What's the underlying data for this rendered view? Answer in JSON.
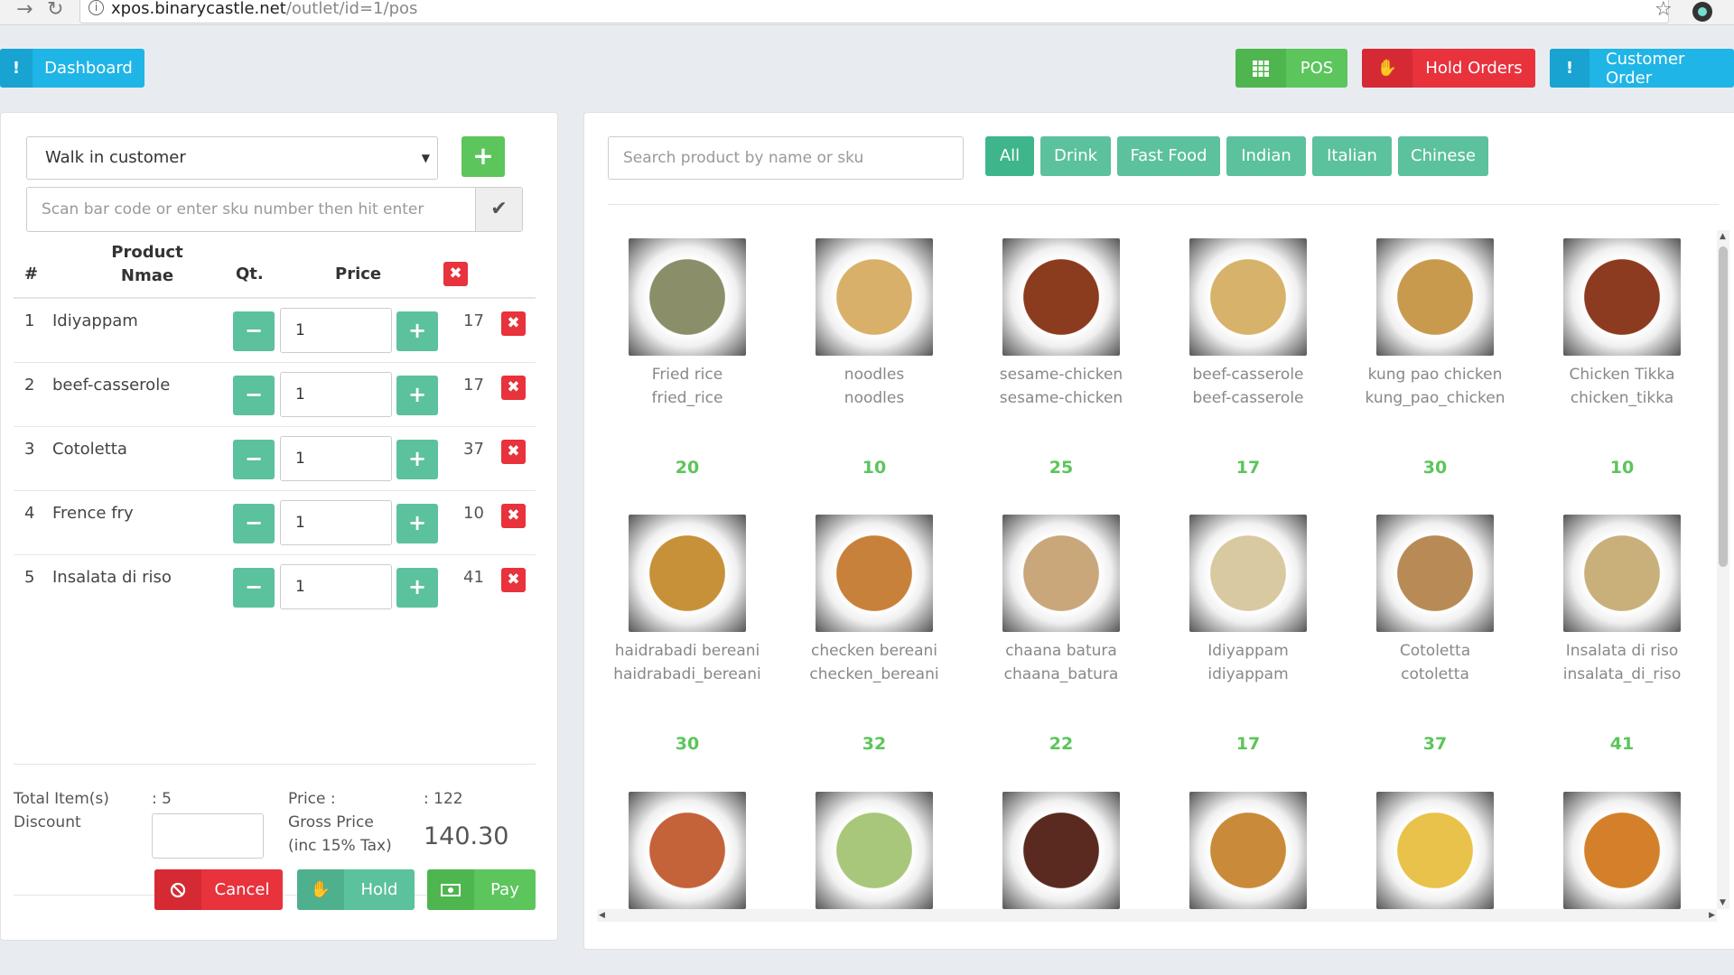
{
  "browser": {
    "url_host": "xpos.binarycastle.net",
    "url_path": "/outlet/id=1/pos"
  },
  "topbar": {
    "dashboard_label": "Dashboard",
    "pos_label": "POS",
    "hold_orders_label": "Hold Orders",
    "customer_order_label": "Customer Order"
  },
  "cart": {
    "customer_select": "Walk in customer",
    "scan_placeholder": "Scan bar code or enter sku number then hit enter",
    "headers": {
      "num": "#",
      "product": "Product Nmae",
      "qty": "Qt.",
      "price": "Price"
    },
    "items": [
      {
        "n": "1",
        "name": "Idiyappam",
        "qty": "1",
        "price": "17"
      },
      {
        "n": "2",
        "name": "beef-casserole",
        "qty": "1",
        "price": "17"
      },
      {
        "n": "3",
        "name": "Cotoletta",
        "qty": "1",
        "price": "37"
      },
      {
        "n": "4",
        "name": "Frence fry",
        "qty": "1",
        "price": "10"
      },
      {
        "n": "5",
        "name": "Insalata di riso",
        "qty": "1",
        "price": "41"
      }
    ],
    "summary": {
      "total_items_label": "Total Item(s)",
      "total_items_value": ": 5",
      "discount_label": "Discount",
      "price_label": "Price :",
      "price_value": ": 122",
      "gross_label_1": "Gross Price",
      "gross_label_2": "(inc 15% Tax)",
      "gross_value": "140.30"
    },
    "buttons": {
      "cancel": "Cancel",
      "hold": "Hold",
      "pay": "Pay"
    }
  },
  "products": {
    "search_placeholder": "Search product by name or sku",
    "categories": [
      "All",
      "Drink",
      "Fast Food",
      "Indian",
      "Italian",
      "Chinese"
    ],
    "items": [
      {
        "name": "Fried rice",
        "sku": "fried_rice",
        "price": "20",
        "color": "#8a8f6a"
      },
      {
        "name": "noodles",
        "sku": "noodles",
        "price": "10",
        "color": "#d9b06a"
      },
      {
        "name": "sesame-chicken",
        "sku": "sesame-chicken",
        "price": "25",
        "color": "#8b3b1e"
      },
      {
        "name": "beef-casserole",
        "sku": "beef-casserole",
        "price": "17",
        "color": "#d7b26a"
      },
      {
        "name": "kung pao chicken",
        "sku": "kung_pao_chicken",
        "price": "30",
        "color": "#c89a4e"
      },
      {
        "name": "Chicken Tikka",
        "sku": "chicken_tikka",
        "price": "10",
        "color": "#8c3a20"
      },
      {
        "name": "haidrabadi bereani",
        "sku": "haidrabadi_bereani",
        "price": "30",
        "color": "#c7913a"
      },
      {
        "name": "checken bereani",
        "sku": "checken_bereani",
        "price": "32",
        "color": "#c8813a"
      },
      {
        "name": "chaana batura",
        "sku": "chaana_batura",
        "price": "22",
        "color": "#c9a77a"
      },
      {
        "name": "Idiyappam",
        "sku": "idiyappam",
        "price": "17",
        "color": "#d8c9a0"
      },
      {
        "name": "Cotoletta",
        "sku": "cotoletta",
        "price": "37",
        "color": "#b88a55"
      },
      {
        "name": "Insalata di riso",
        "sku": "insalata_di_riso",
        "price": "41",
        "color": "#c9b07a"
      },
      {
        "name": "",
        "sku": "",
        "price": "",
        "color": "#c4623a"
      },
      {
        "name": "",
        "sku": "",
        "price": "",
        "color": "#a8c77a"
      },
      {
        "name": "",
        "sku": "",
        "price": "",
        "color": "#5a2a20"
      },
      {
        "name": "",
        "sku": "",
        "price": "",
        "color": "#c98a3a"
      },
      {
        "name": "",
        "sku": "",
        "price": "",
        "color": "#e8c24a"
      },
      {
        "name": "",
        "sku": "",
        "price": "",
        "color": "#d4802a"
      }
    ]
  },
  "colors": {
    "cyan": "#1fb5e6",
    "green": "#5cc55c",
    "teal": "#5cc19d",
    "red": "#e8323c"
  }
}
